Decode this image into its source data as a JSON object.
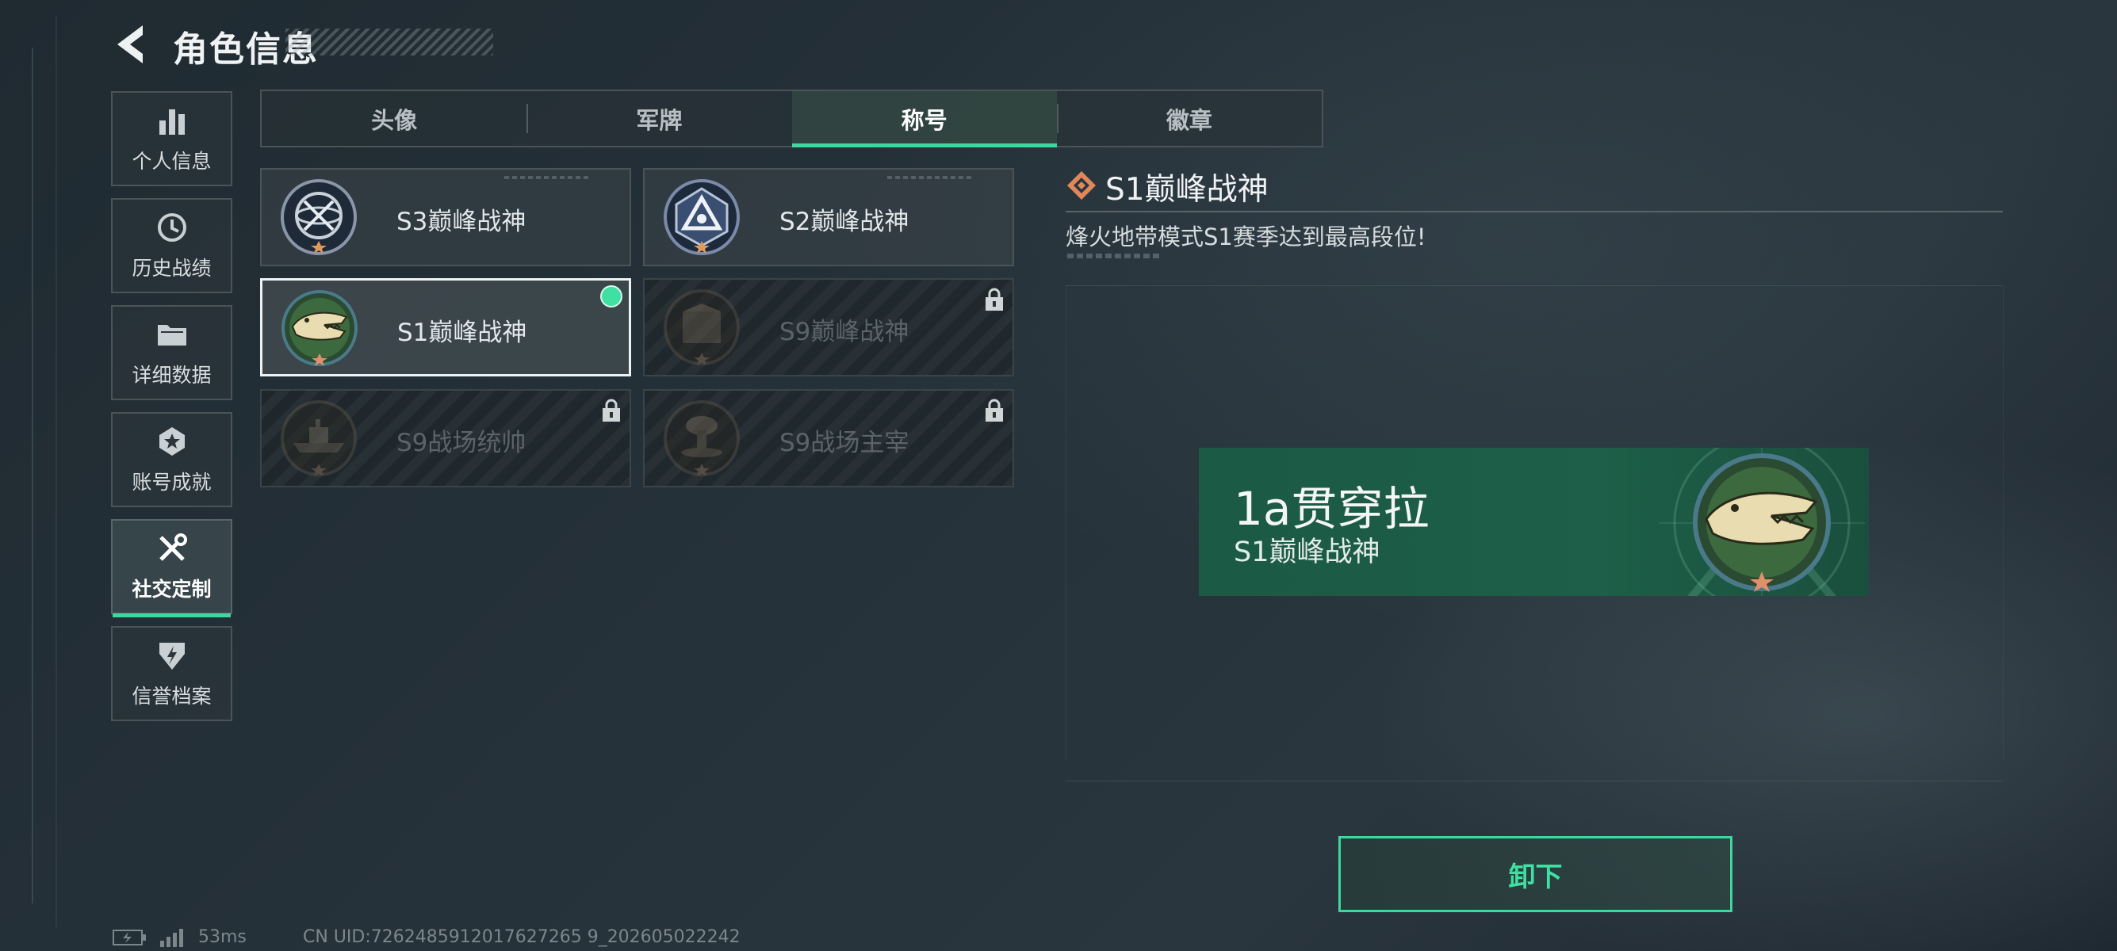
{
  "header": {
    "title": "角色信息"
  },
  "sidebar": {
    "items": [
      {
        "label": "个人信息",
        "icon": "bar-chart-icon"
      },
      {
        "label": "历史战绩",
        "icon": "history-icon"
      },
      {
        "label": "详细数据",
        "icon": "folder-icon"
      },
      {
        "label": "账号成就",
        "icon": "achievement-icon"
      },
      {
        "label": "社交定制",
        "icon": "tools-icon",
        "active": true
      },
      {
        "label": "信誉档案",
        "icon": "shield-icon"
      }
    ]
  },
  "tabs": [
    {
      "label": "头像"
    },
    {
      "label": "军牌"
    },
    {
      "label": "称号",
      "active": true
    },
    {
      "label": "徽章"
    }
  ],
  "titles": [
    {
      "name": "S3巅峰战神",
      "locked": false,
      "selected": false
    },
    {
      "name": "S2巅峰战神",
      "locked": false,
      "selected": false
    },
    {
      "name": "S1巅峰战神",
      "locked": false,
      "selected": true
    },
    {
      "name": "S9巅峰战神",
      "locked": true,
      "selected": false
    },
    {
      "name": "S9战场统帅",
      "locked": true,
      "selected": false
    },
    {
      "name": "S9战场主宰",
      "locked": true,
      "selected": false
    }
  ],
  "detail": {
    "title": "S1巅峰战神",
    "description": "烽火地带模式S1赛季达到最高段位!"
  },
  "preview": {
    "player_name": "1a贯穿拉",
    "title": "S1巅峰战神"
  },
  "actions": {
    "unequip_label": "卸下"
  },
  "status": {
    "ping": "53ms",
    "uid": "CN UID:7262485912017627265 9_202605022242"
  },
  "colors": {
    "accent": "#3fd6a0",
    "banner": "#1d5f48",
    "selected_dot": "#3fe0a2"
  }
}
